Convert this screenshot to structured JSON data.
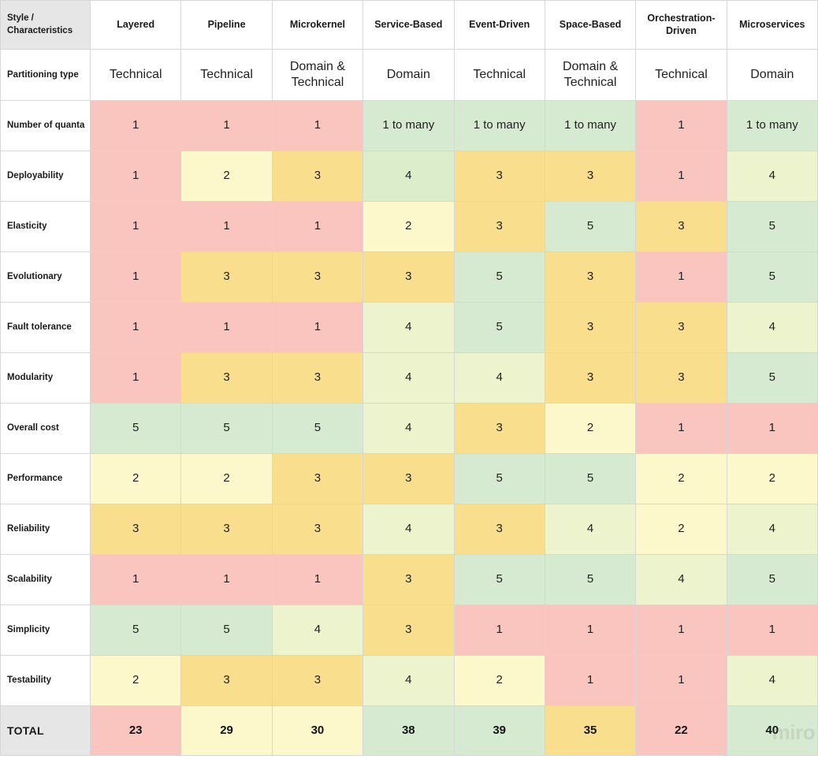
{
  "table": {
    "corner_label": "Style / Characteristics",
    "columns": [
      "Layered",
      "Pipeline",
      "Microkernel",
      "Service-Based",
      "Event-Driven",
      "Space-Based",
      "Orchestration-Driven",
      "Microservices"
    ],
    "total_label": "TOTAL",
    "rows": [
      {
        "label": "Partitioning type",
        "kind": "text",
        "values": [
          "Technical",
          "Technical",
          "Domain & Technical",
          "Domain",
          "Technical",
          "Domain & Technical",
          "Technical",
          "Domain"
        ]
      },
      {
        "label": "Number of quanta",
        "kind": "text",
        "values": [
          "1",
          "1",
          "1",
          "1 to many",
          "1 to many",
          "1 to many",
          "1",
          "1 to many"
        ],
        "colors": [
          "s1",
          "s1",
          "s1",
          "s5",
          "s5",
          "s5",
          "s1",
          "s5"
        ]
      },
      {
        "label": "Deployability",
        "kind": "score",
        "values": [
          "1",
          "2",
          "3",
          "4",
          "3",
          "3",
          "1",
          "4"
        ],
        "colors": [
          "s1",
          "s2",
          "s3",
          "s4",
          "s3",
          "s3",
          "s1",
          "s4b"
        ]
      },
      {
        "label": "Elasticity",
        "kind": "score",
        "values": [
          "1",
          "1",
          "1",
          "2",
          "3",
          "5",
          "3",
          "5"
        ],
        "colors": [
          "s1",
          "s1",
          "s1",
          "s2",
          "s3",
          "s5",
          "s3",
          "s5"
        ]
      },
      {
        "label": "Evolutionary",
        "kind": "score",
        "values": [
          "1",
          "3",
          "3",
          "3",
          "5",
          "3",
          "1",
          "5"
        ],
        "colors": [
          "s1",
          "s3",
          "s3",
          "s3",
          "s5",
          "s3",
          "s1",
          "s5"
        ]
      },
      {
        "label": "Fault tolerance",
        "kind": "score",
        "values": [
          "1",
          "1",
          "1",
          "4",
          "5",
          "3",
          "3",
          "4"
        ],
        "colors": [
          "s1",
          "s1",
          "s1",
          "s4b",
          "s5",
          "s3",
          "s3",
          "s4b"
        ]
      },
      {
        "label": "Modularity",
        "kind": "score",
        "values": [
          "1",
          "3",
          "3",
          "4",
          "4",
          "3",
          "3",
          "5"
        ],
        "colors": [
          "s1",
          "s3",
          "s3",
          "s4b",
          "s4b",
          "s3",
          "s3",
          "s5"
        ]
      },
      {
        "label": "Overall cost",
        "kind": "score",
        "values": [
          "5",
          "5",
          "5",
          "4",
          "3",
          "2",
          "1",
          "1"
        ],
        "colors": [
          "s5",
          "s5",
          "s5",
          "s4b",
          "s3",
          "s2",
          "s1",
          "s1"
        ]
      },
      {
        "label": "Performance",
        "kind": "score",
        "values": [
          "2",
          "2",
          "3",
          "3",
          "5",
          "5",
          "2",
          "2"
        ],
        "colors": [
          "s2",
          "s2",
          "s3",
          "s3",
          "s5",
          "s5",
          "s2",
          "s2"
        ]
      },
      {
        "label": "Reliability",
        "kind": "score",
        "values": [
          "3",
          "3",
          "3",
          "4",
          "3",
          "4",
          "2",
          "4"
        ],
        "colors": [
          "s3",
          "s3",
          "s3",
          "s4b",
          "s3",
          "s4b",
          "s2",
          "s4b"
        ]
      },
      {
        "label": "Scalability",
        "kind": "score",
        "values": [
          "1",
          "1",
          "1",
          "3",
          "5",
          "5",
          "4",
          "5"
        ],
        "colors": [
          "s1",
          "s1",
          "s1",
          "s3",
          "s5",
          "s5",
          "s4b",
          "s5"
        ]
      },
      {
        "label": "Simplicity",
        "kind": "score",
        "values": [
          "5",
          "5",
          "4",
          "3",
          "1",
          "1",
          "1",
          "1"
        ],
        "colors": [
          "s5",
          "s5",
          "s4b",
          "s3",
          "s1",
          "s1",
          "s1",
          "s1"
        ]
      },
      {
        "label": "Testability",
        "kind": "score",
        "values": [
          "2",
          "3",
          "3",
          "4",
          "2",
          "1",
          "1",
          "4"
        ],
        "colors": [
          "s2",
          "s3",
          "s3",
          "s4b",
          "s2",
          "s1",
          "s1",
          "s4b"
        ]
      }
    ],
    "totals": {
      "values": [
        "23",
        "29",
        "30",
        "38",
        "39",
        "35",
        "22",
        "40"
      ],
      "colors": [
        "s1",
        "s2",
        "s2",
        "s5",
        "s5",
        "s3",
        "s1",
        "s5"
      ]
    }
  },
  "watermark": {
    "text": "miro"
  },
  "legend": {
    "scale_colors": {
      "score_1": "#f9c5be",
      "score_2": "#fcf8cc",
      "score_3": "#f8de8d",
      "score_4": "#dcedcb",
      "score_4_alt": "#edf3cc",
      "score_5": "#d5ead0",
      "header_gray": "#e6e6e6",
      "grid_line": "#d6d6d6"
    }
  }
}
